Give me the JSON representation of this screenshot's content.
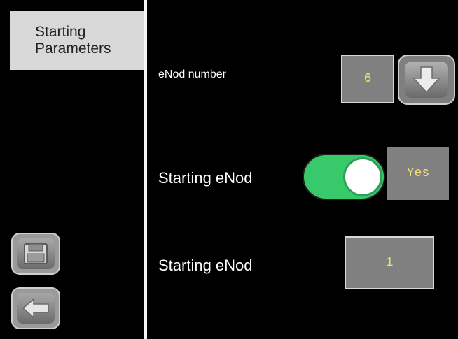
{
  "sidebar": {
    "tab": {
      "line1": "Starting",
      "line2": "Parameters"
    },
    "buttons": [
      {
        "icon": "save-icon"
      },
      {
        "icon": "back-arrow-icon"
      }
    ]
  },
  "main": {
    "enod_number": {
      "label": "eNod number",
      "value": "6",
      "button_icon": "arrow-down-icon"
    },
    "starting_toggle": {
      "label": "Starting eNod",
      "state": true,
      "value": "Yes"
    },
    "starting_value": {
      "label": "Starting eNod",
      "value": "1"
    }
  },
  "colors": {
    "background": "#000000",
    "tab_bg": "#d8d8d8",
    "value_box_bg": "#808080",
    "value_text": "#f0e27a",
    "toggle_on": "#37c96a"
  }
}
